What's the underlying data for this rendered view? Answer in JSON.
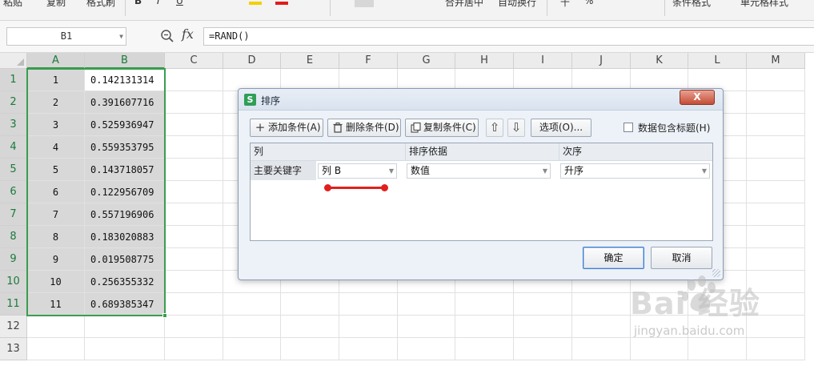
{
  "ribbon": {
    "items": [
      "粘贴",
      "复制",
      "格式刷",
      "B",
      "I",
      "U",
      "合并居中",
      "自动换行",
      "千",
      "%",
      "条件格式",
      "单元格样式"
    ]
  },
  "formula_bar": {
    "name_box": "B1",
    "fx_label": "fx",
    "formula": "=RAND()"
  },
  "sheet": {
    "columns": [
      "A",
      "B",
      "C",
      "D",
      "E",
      "F",
      "G",
      "H",
      "I",
      "J",
      "K",
      "L",
      "M"
    ],
    "rows": [
      "1",
      "2",
      "3",
      "4",
      "5",
      "6",
      "7",
      "8",
      "9",
      "10",
      "11",
      "12",
      "13"
    ],
    "col_a": [
      "1",
      "2",
      "3",
      "4",
      "5",
      "6",
      "7",
      "8",
      "9",
      "10",
      "11"
    ],
    "col_b": [
      "0.142131314",
      "0.391607716",
      "0.525936947",
      "0.559353795",
      "0.143718057",
      "0.122956709",
      "0.557196906",
      "0.183020883",
      "0.019508775",
      "0.256355332",
      "0.689385347"
    ]
  },
  "dialog": {
    "title": "排序",
    "logo_letter": "S",
    "close_label": "X",
    "buttons": {
      "add": "添加条件(A)",
      "delete": "删除条件(D)",
      "copy": "复制条件(C)",
      "options": "选项(O)..."
    },
    "has_header_label": "数据包含标题(H)",
    "has_header_checked": false,
    "table_headers": {
      "column": "列",
      "sort_on": "排序依据",
      "order": "次序"
    },
    "row": {
      "key_label": "主要关键字",
      "column_value": "列 B",
      "sort_on_value": "数值",
      "order_value": "升序"
    },
    "ok_label": "确定",
    "cancel_label": "取消"
  },
  "watermark": {
    "brand": "Bai  经验",
    "url": "jingyan.baidu.com"
  },
  "colors": {
    "selection_green": "#3a9d4f",
    "annotation_red": "#e0201d",
    "close_red": "#c44d36"
  }
}
